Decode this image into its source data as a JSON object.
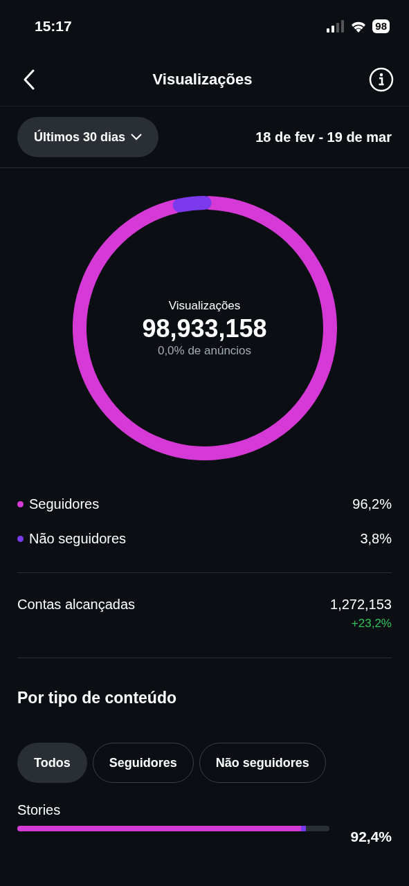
{
  "status_bar": {
    "time": "15:17",
    "battery": "98"
  },
  "header": {
    "title": "Visualizações"
  },
  "filter": {
    "period": "Últimos 30 dias",
    "date_range": "18 de fev - 19 de mar"
  },
  "summary": {
    "label": "Visualizações",
    "value": "98,933,158",
    "ads": "0,0% de anúncios"
  },
  "legend": [
    {
      "label": "Seguidores",
      "value": "96,2%",
      "color": "#d63ad6"
    },
    {
      "label": "Não seguidores",
      "value": "3,8%",
      "color": "#7c3aed"
    }
  ],
  "reach": {
    "label": "Contas alcançadas",
    "value": "1,272,153",
    "change": "+23,2%"
  },
  "content_section": {
    "title": "Por tipo de conteúdo",
    "chips": [
      {
        "label": "Todos",
        "selected": true
      },
      {
        "label": "Seguidores",
        "selected": false
      },
      {
        "label": "Não seguidores",
        "selected": false
      }
    ],
    "rows": [
      {
        "label": "Stories",
        "value": "92,4%",
        "level": 0.908
      }
    ]
  }
}
